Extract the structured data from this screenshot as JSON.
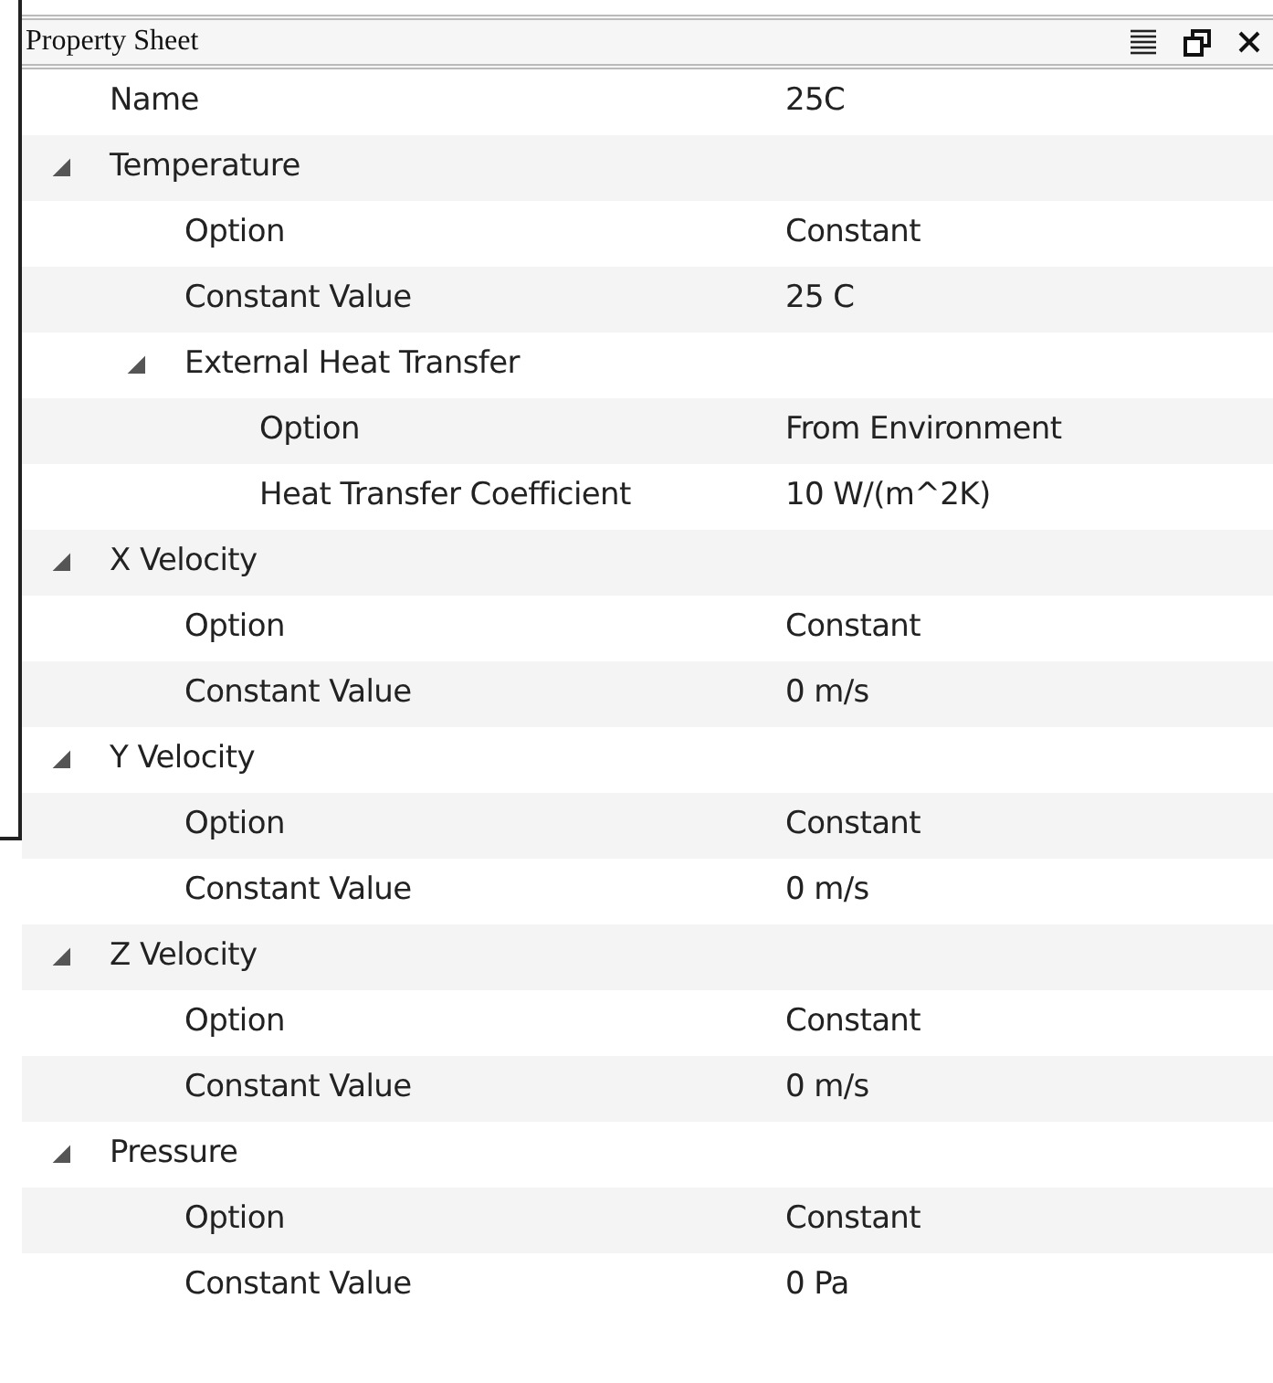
{
  "panel": {
    "title": "Property Sheet"
  },
  "properties": [
    {
      "name": "Name",
      "value": "25C"
    },
    {
      "name": "Temperature",
      "expanded": true,
      "children": [
        {
          "name": "Option",
          "value": "Constant"
        },
        {
          "name": "Constant Value",
          "value": "25 C"
        },
        {
          "name": "External Heat Transfer",
          "expanded": true,
          "children": [
            {
              "name": "Option",
              "value": "From Environment"
            },
            {
              "name": "Heat Transfer Coefficient",
              "value": "10 W/(m^2K)"
            }
          ]
        }
      ]
    },
    {
      "name": "X Velocity",
      "expanded": true,
      "children": [
        {
          "name": "Option",
          "value": "Constant"
        },
        {
          "name": "Constant Value",
          "value": "0 m/s"
        }
      ]
    },
    {
      "name": "Y Velocity",
      "expanded": true,
      "children": [
        {
          "name": "Option",
          "value": "Constant"
        },
        {
          "name": "Constant Value",
          "value": "0 m/s"
        }
      ]
    },
    {
      "name": "Z Velocity",
      "expanded": true,
      "children": [
        {
          "name": "Option",
          "value": "Constant"
        },
        {
          "name": "Constant Value",
          "value": "0 m/s"
        }
      ]
    },
    {
      "name": "Pressure",
      "expanded": true,
      "children": [
        {
          "name": "Option",
          "value": "Constant"
        },
        {
          "name": "Constant Value",
          "value": "0 Pa"
        }
      ]
    }
  ]
}
